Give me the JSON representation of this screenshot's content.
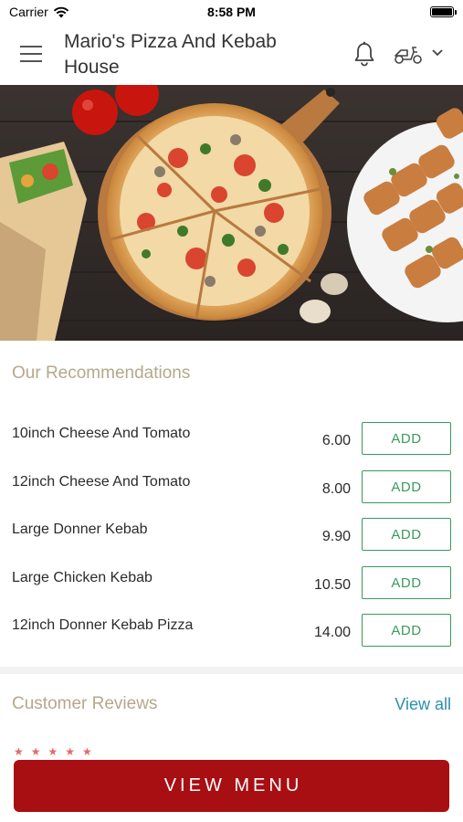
{
  "status_bar": {
    "carrier": "Carrier",
    "time": "8:58 PM"
  },
  "header": {
    "title": "Mario's Pizza And Kebab House"
  },
  "recommendations": {
    "title": "Our Recommendations",
    "add_label": "ADD",
    "items": [
      {
        "name": "10inch Cheese And Tomato",
        "price": "6.00"
      },
      {
        "name": "12inch Cheese And Tomato",
        "price": "8.00"
      },
      {
        "name": "Large Donner Kebab",
        "price": "9.90"
      },
      {
        "name": "Large Chicken Kebab",
        "price": "10.50"
      },
      {
        "name": "12inch Donner Kebab Pizza",
        "price": "14.00"
      }
    ]
  },
  "reviews": {
    "title": "Customer Reviews",
    "view_all": "View all"
  },
  "footer": {
    "view_menu": "VIEW MENU"
  },
  "colors": {
    "accent_red": "#a80f12",
    "section_title": "#b5a88a",
    "add_green": "#3a9a5c",
    "link_blue": "#2b8fb0"
  }
}
